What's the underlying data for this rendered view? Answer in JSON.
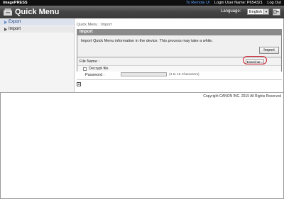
{
  "topbar": {
    "brand": "imagePRESS",
    "to_remote_ui": "To Remote UI",
    "login_user_label": "Login User Name: P654321",
    "logout": "Log Out"
  },
  "header": {
    "title": "Quick Menu",
    "language_label": "Language:",
    "language_value": "English"
  },
  "sidebar": {
    "items": [
      {
        "label": "Export",
        "icon": "arrow-right-icon"
      },
      {
        "label": "Import",
        "icon": "arrow-right-icon"
      }
    ]
  },
  "main": {
    "breadcrumb": "Quick Menu : Import",
    "panel": {
      "title": "Import",
      "message": "Import Quick Menu information in the device. This process may take a while.",
      "import_button": "Import"
    },
    "file_name_label": "File Name :",
    "browse_button": "Examinar...",
    "decrypt_label": "Decrypt file",
    "password_label": "Password :",
    "password_hint": "(4 to 16 Characters)"
  },
  "footer": {
    "copyright": "Copyright CANON INC. 2015 All Rights Reserved"
  },
  "colors": {
    "highlight": "#d11a2a",
    "topbar": "#0f0f0f",
    "link_blue": "#5aa2ff"
  }
}
